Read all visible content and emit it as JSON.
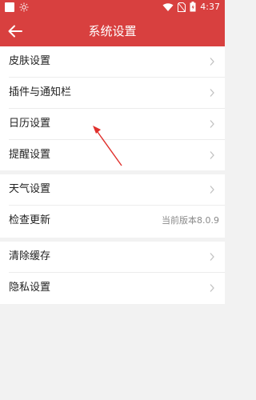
{
  "status": {
    "time": "4:37"
  },
  "header": {
    "title": "系统设置"
  },
  "groups": [
    {
      "items": [
        {
          "label": "皮肤设置"
        },
        {
          "label": "插件与通知栏"
        },
        {
          "label": "日历设置"
        },
        {
          "label": "提醒设置"
        }
      ]
    },
    {
      "items": [
        {
          "label": "天气设置"
        },
        {
          "label": "检查更新",
          "value": "当前版本8.0.9"
        }
      ]
    },
    {
      "items": [
        {
          "label": "清除缓存"
        },
        {
          "label": "隐私设置"
        }
      ]
    }
  ],
  "colors": {
    "accent": "#d8403f",
    "annotation": "#e0302c"
  }
}
